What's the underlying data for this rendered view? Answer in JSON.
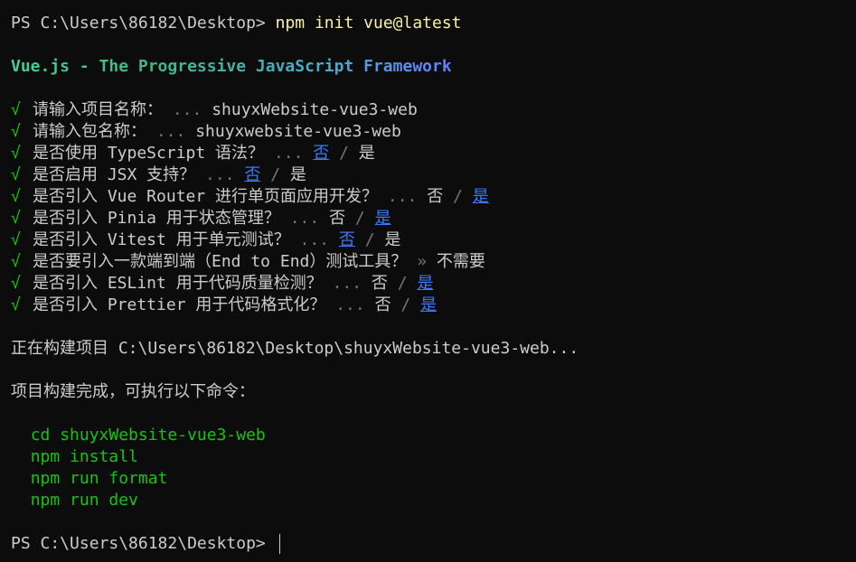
{
  "session": {
    "prompt": "PS C:\\Users\\86182\\Desktop> ",
    "command": "npm init vue@latest"
  },
  "banner": "Vue.js - The Progressive JavaScript Framework",
  "questions": [
    {
      "check": "√",
      "question": "请输入项目名称：",
      "sep": "...",
      "answer": "shuyxWebsite-vue3-web"
    },
    {
      "check": "√",
      "question": "请输入包名称：",
      "sep": "...",
      "answer": "shuyxwebsite-vue3-web"
    },
    {
      "check": "√",
      "question": "是否使用 TypeScript 语法？",
      "sep": "...",
      "no": "否",
      "slash": "/",
      "yes": "是",
      "selected": "no"
    },
    {
      "check": "√",
      "question": "是否启用 JSX 支持？",
      "sep": "...",
      "no": "否",
      "slash": "/",
      "yes": "是",
      "selected": "no"
    },
    {
      "check": "√",
      "question": "是否引入 Vue Router 进行单页面应用开发？",
      "sep": "...",
      "no": "否",
      "slash": "/",
      "yes": "是",
      "selected": "yes"
    },
    {
      "check": "√",
      "question": "是否引入 Pinia 用于状态管理？",
      "sep": "...",
      "no": "否",
      "slash": "/",
      "yes": "是",
      "selected": "yes"
    },
    {
      "check": "√",
      "question": "是否引入 Vitest 用于单元测试？",
      "sep": "...",
      "no": "否",
      "slash": "/",
      "yes": "是",
      "selected": "no"
    },
    {
      "check": "√",
      "question": "是否要引入一款端到端（End to End）测试工具？",
      "sep": "»",
      "answer": "不需要"
    },
    {
      "check": "√",
      "question": "是否引入 ESLint 用于代码质量检测？",
      "sep": "...",
      "no": "否",
      "slash": "/",
      "yes": "是",
      "selected": "yes"
    },
    {
      "check": "√",
      "question": "是否引入 Prettier 用于代码格式化？",
      "sep": "...",
      "no": "否",
      "slash": "/",
      "yes": "是",
      "selected": "yes"
    }
  ],
  "building": "正在构建项目 C:\\Users\\86182\\Desktop\\shuyxWebsite-vue3-web...",
  "done": "项目构建完成，可执行以下命令：",
  "next_commands": [
    "cd shuyxWebsite-vue3-web",
    "npm install",
    "npm run format",
    "npm run dev"
  ],
  "final_prompt": "PS C:\\Users\\86182\\Desktop> ",
  "colors": {
    "background": "#0c0c0c",
    "text": "#cccccc",
    "command": "#f9f1a5",
    "success": "#16c60c",
    "selected": "#3b78ff",
    "dim": "#767676"
  }
}
